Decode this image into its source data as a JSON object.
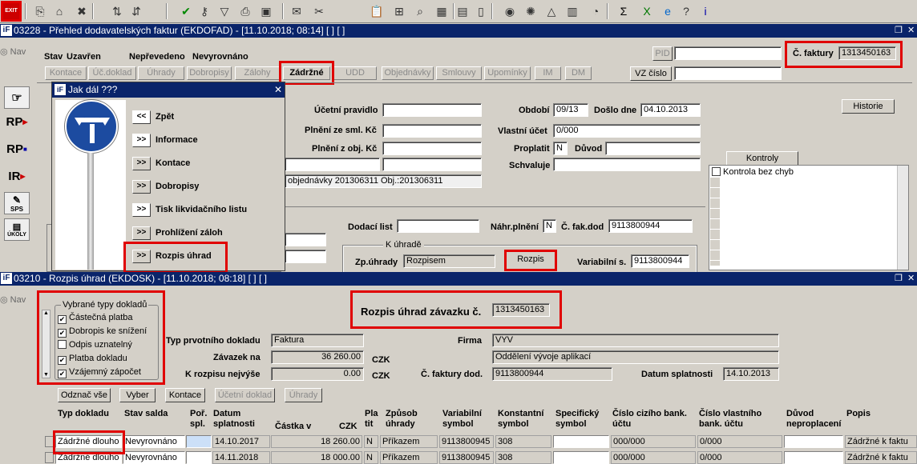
{
  "toolbar": {
    "exit_label": "EXIT",
    "icons": [
      "copy-icon",
      "home-icon",
      "wrench-icon",
      "sort-asc-icon",
      "sort-desc-icon",
      "check-icon",
      "key-icon",
      "filter-icon",
      "print-icon",
      "print-preview-icon",
      "mail-icon",
      "cut-icon",
      "paste-icon",
      "tree-icon",
      "zoom-icon",
      "grid-icon",
      "calendar-icon",
      "save-icon",
      "globe-icon",
      "settings-icon",
      "triangle-icon",
      "calculator-icon",
      "clock-icon",
      "sum-icon",
      "excel-icon",
      "ie-icon",
      "help-icon",
      "info-icon"
    ]
  },
  "window1": {
    "title": "03228 - Přehled dodavatelských faktur (EKDOFAD) - [11.10.2018; 08:14]  [ ]  [ ]",
    "nav": "Nav",
    "stav_label": "Stav",
    "stav_value": "Uzavřen",
    "neprevedeno": "Nepřevedeno",
    "nevyrovnano": "Nevyrovnáno",
    "pid_label": "PID",
    "pid_value": "",
    "cislo_faktury_label": "Č. faktury",
    "cislo_faktury_value": "1313450163",
    "vz_cislo_label": "VZ číslo",
    "vz_cislo_value": "",
    "tabs": [
      "Kontace",
      "Úč.doklad",
      "Úhrady",
      "Dobropisy",
      "Zálohy",
      "Zádržné",
      "UDD",
      "Objednávky",
      "Smlouvy",
      "Upomínky",
      "IM",
      "DM"
    ],
    "ucetni_pravidlo_label": "Účetní pravidlo",
    "plneni_sml_label": "Plnění ze sml. Kč",
    "plneni_obj_label": "Plnění z obj. Kč",
    "obdobi_label": "Období",
    "obdobi_value": "09/13",
    "doslo_label": "Došlo dne",
    "doslo_value": "04.10.2013",
    "vlastni_ucet_label": "Vlastní účet",
    "vlastni_ucet_value": "0/000",
    "proplatit_label": "Proplatit",
    "proplatit_value": "N",
    "duvod_label": "Důvod",
    "schvaluje_label": "Schvaluje",
    "objednavky_text": "objednávky 201306311 Obj.:201306311",
    "historie": "Historie",
    "kontroly": "Kontroly",
    "kontrola_bez_chyb": "Kontrola bez chyb",
    "dodaci_list_label": "Dodací list",
    "nahr_plneni_label": "Náhr.plnění",
    "nahr_plneni_value": "N",
    "c_fak_dod_label": "Č. fak.dod",
    "c_fak_dod_value": "9113800944",
    "k_uhrade": "K úhradě",
    "zp_uhrady_label": "Zp.úhrady",
    "zp_uhrady_value": "Rozpisem",
    "rozpis_button": "Rozpis",
    "variabilni_label": "Variabilní s.",
    "variabilni_value": "9113800944"
  },
  "side_buttons": [
    "RP",
    "RP",
    "IR",
    "SPS",
    "ÚKOLY"
  ],
  "dialog": {
    "title": "Jak dál ???",
    "items": [
      {
        "arrow": "<<",
        "label": "Zpět"
      },
      {
        "arrow": ">>",
        "label": "Informace"
      },
      {
        "arrow": ">>",
        "label": "Kontace"
      },
      {
        "arrow": ">>",
        "label": "Dobropisy"
      },
      {
        "arrow": ">>",
        "label": "Tisk likvidačního listu"
      },
      {
        "arrow": ">>",
        "label": "Prohlížení záloh"
      },
      {
        "arrow": ">>",
        "label": "Rozpis úhrad"
      }
    ]
  },
  "window2": {
    "title": "03210 - Rozpis úhrad (EKDOSK) - [11.10.2018; 08:18]  [ ]  [ ]",
    "nav": "Nav",
    "group_title": "Vybrané typy dokladů",
    "checks": [
      {
        "label": "Částečná platba",
        "checked": true
      },
      {
        "label": "Dobropis ke snížení",
        "checked": true
      },
      {
        "label": "Odpis uznatelný",
        "checked": false
      },
      {
        "label": "Platba dokladu",
        "checked": true
      },
      {
        "label": "Vzájemný zápočet",
        "checked": true
      }
    ],
    "heading": "Rozpis úhrad závazku č.",
    "heading_value": "1313450163",
    "typ_label": "Typ prvotního dokladu",
    "typ_value": "Faktura",
    "zavazek_label": "Závazek na",
    "zavazek_value": "36 260.00",
    "k_rozpisu_label": "K rozpisu nejvýše",
    "k_rozpisu_value": "0.00",
    "czk": "CZK",
    "firma_label": "Firma",
    "firma_value": "VYV",
    "oddeleni_value": "Oddělení vývoje aplikací",
    "c_fakt_dod_label": "Č. faktury dod.",
    "c_fakt_dod_value": "9113800944",
    "datum_spl_label": "Datum splatnosti",
    "datum_spl_value": "14.10.2013",
    "buttons": [
      "Odznač vše",
      "Vyber",
      "Kontace",
      "Účetní doklad",
      "Úhrady"
    ],
    "columns": [
      "Typ dokladu",
      "Stav salda",
      "Poř. spl.",
      "Datum splatnosti",
      "Částka v",
      "CZK",
      "Pla tit",
      "Způsob úhrady",
      "Variabilní symbol",
      "Konstantní symbol",
      "Specifický symbol",
      "Číslo cizího bank. účtu",
      "Číslo vlastního bank. účtu",
      "Důvod neproplacení",
      "Popis"
    ],
    "rows": [
      [
        "Zádržné dlouho",
        "Nevyrovnáno",
        "",
        "14.10.2017",
        "18 260.00",
        "N",
        "Příkazem",
        "9113800945",
        "308",
        "",
        "000/000",
        "0/000",
        "",
        "Zádržné k faktu"
      ],
      [
        "Zádržné dlouho",
        "Nevyrovnáno",
        "",
        "14.11.2018",
        "18 000.00",
        "N",
        "Příkazem",
        "9113800945",
        "308",
        "",
        "000/000",
        "0/000",
        "",
        "Zádržné k faktu"
      ]
    ]
  }
}
